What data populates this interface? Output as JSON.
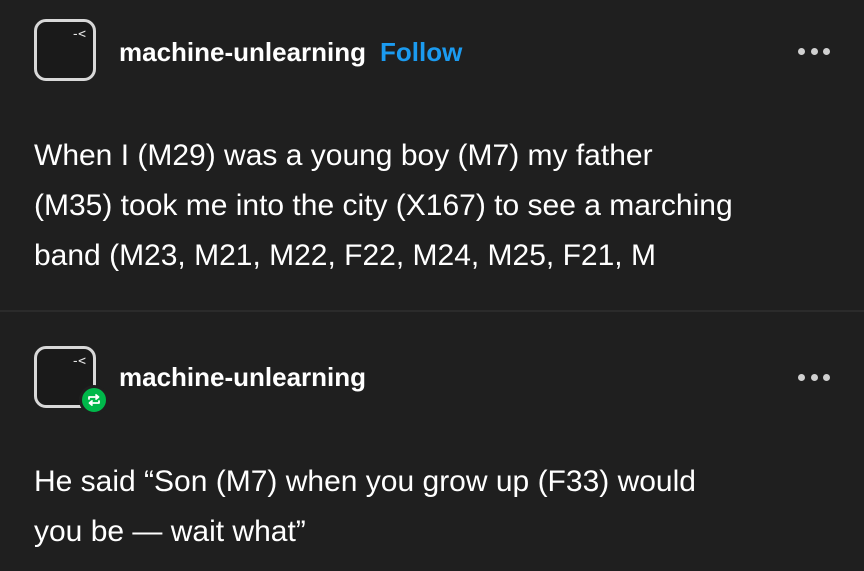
{
  "posts": [
    {
      "username": "machine-unlearning",
      "follow_label": "Follow",
      "avatar_glyph": "-<",
      "text_lines": [
        "When I (M29) was a young boy (M7) my father",
        "(M35) took me into the city (X167) to see a marching",
        "band (M23, M21, M22, F22, M24, M25, F21, M"
      ]
    },
    {
      "username": "machine-unlearning",
      "avatar_glyph": "-<",
      "badge_icon": "reblog-icon",
      "text_lines": [
        "He said “Son (M7) when you grow up (F33) would",
        "you be — wait what”"
      ]
    }
  ],
  "colors": {
    "background": "#1f1f1f",
    "follow": "#1b9bf0",
    "reblog_badge": "#00b84a",
    "text": "#ffffff"
  }
}
